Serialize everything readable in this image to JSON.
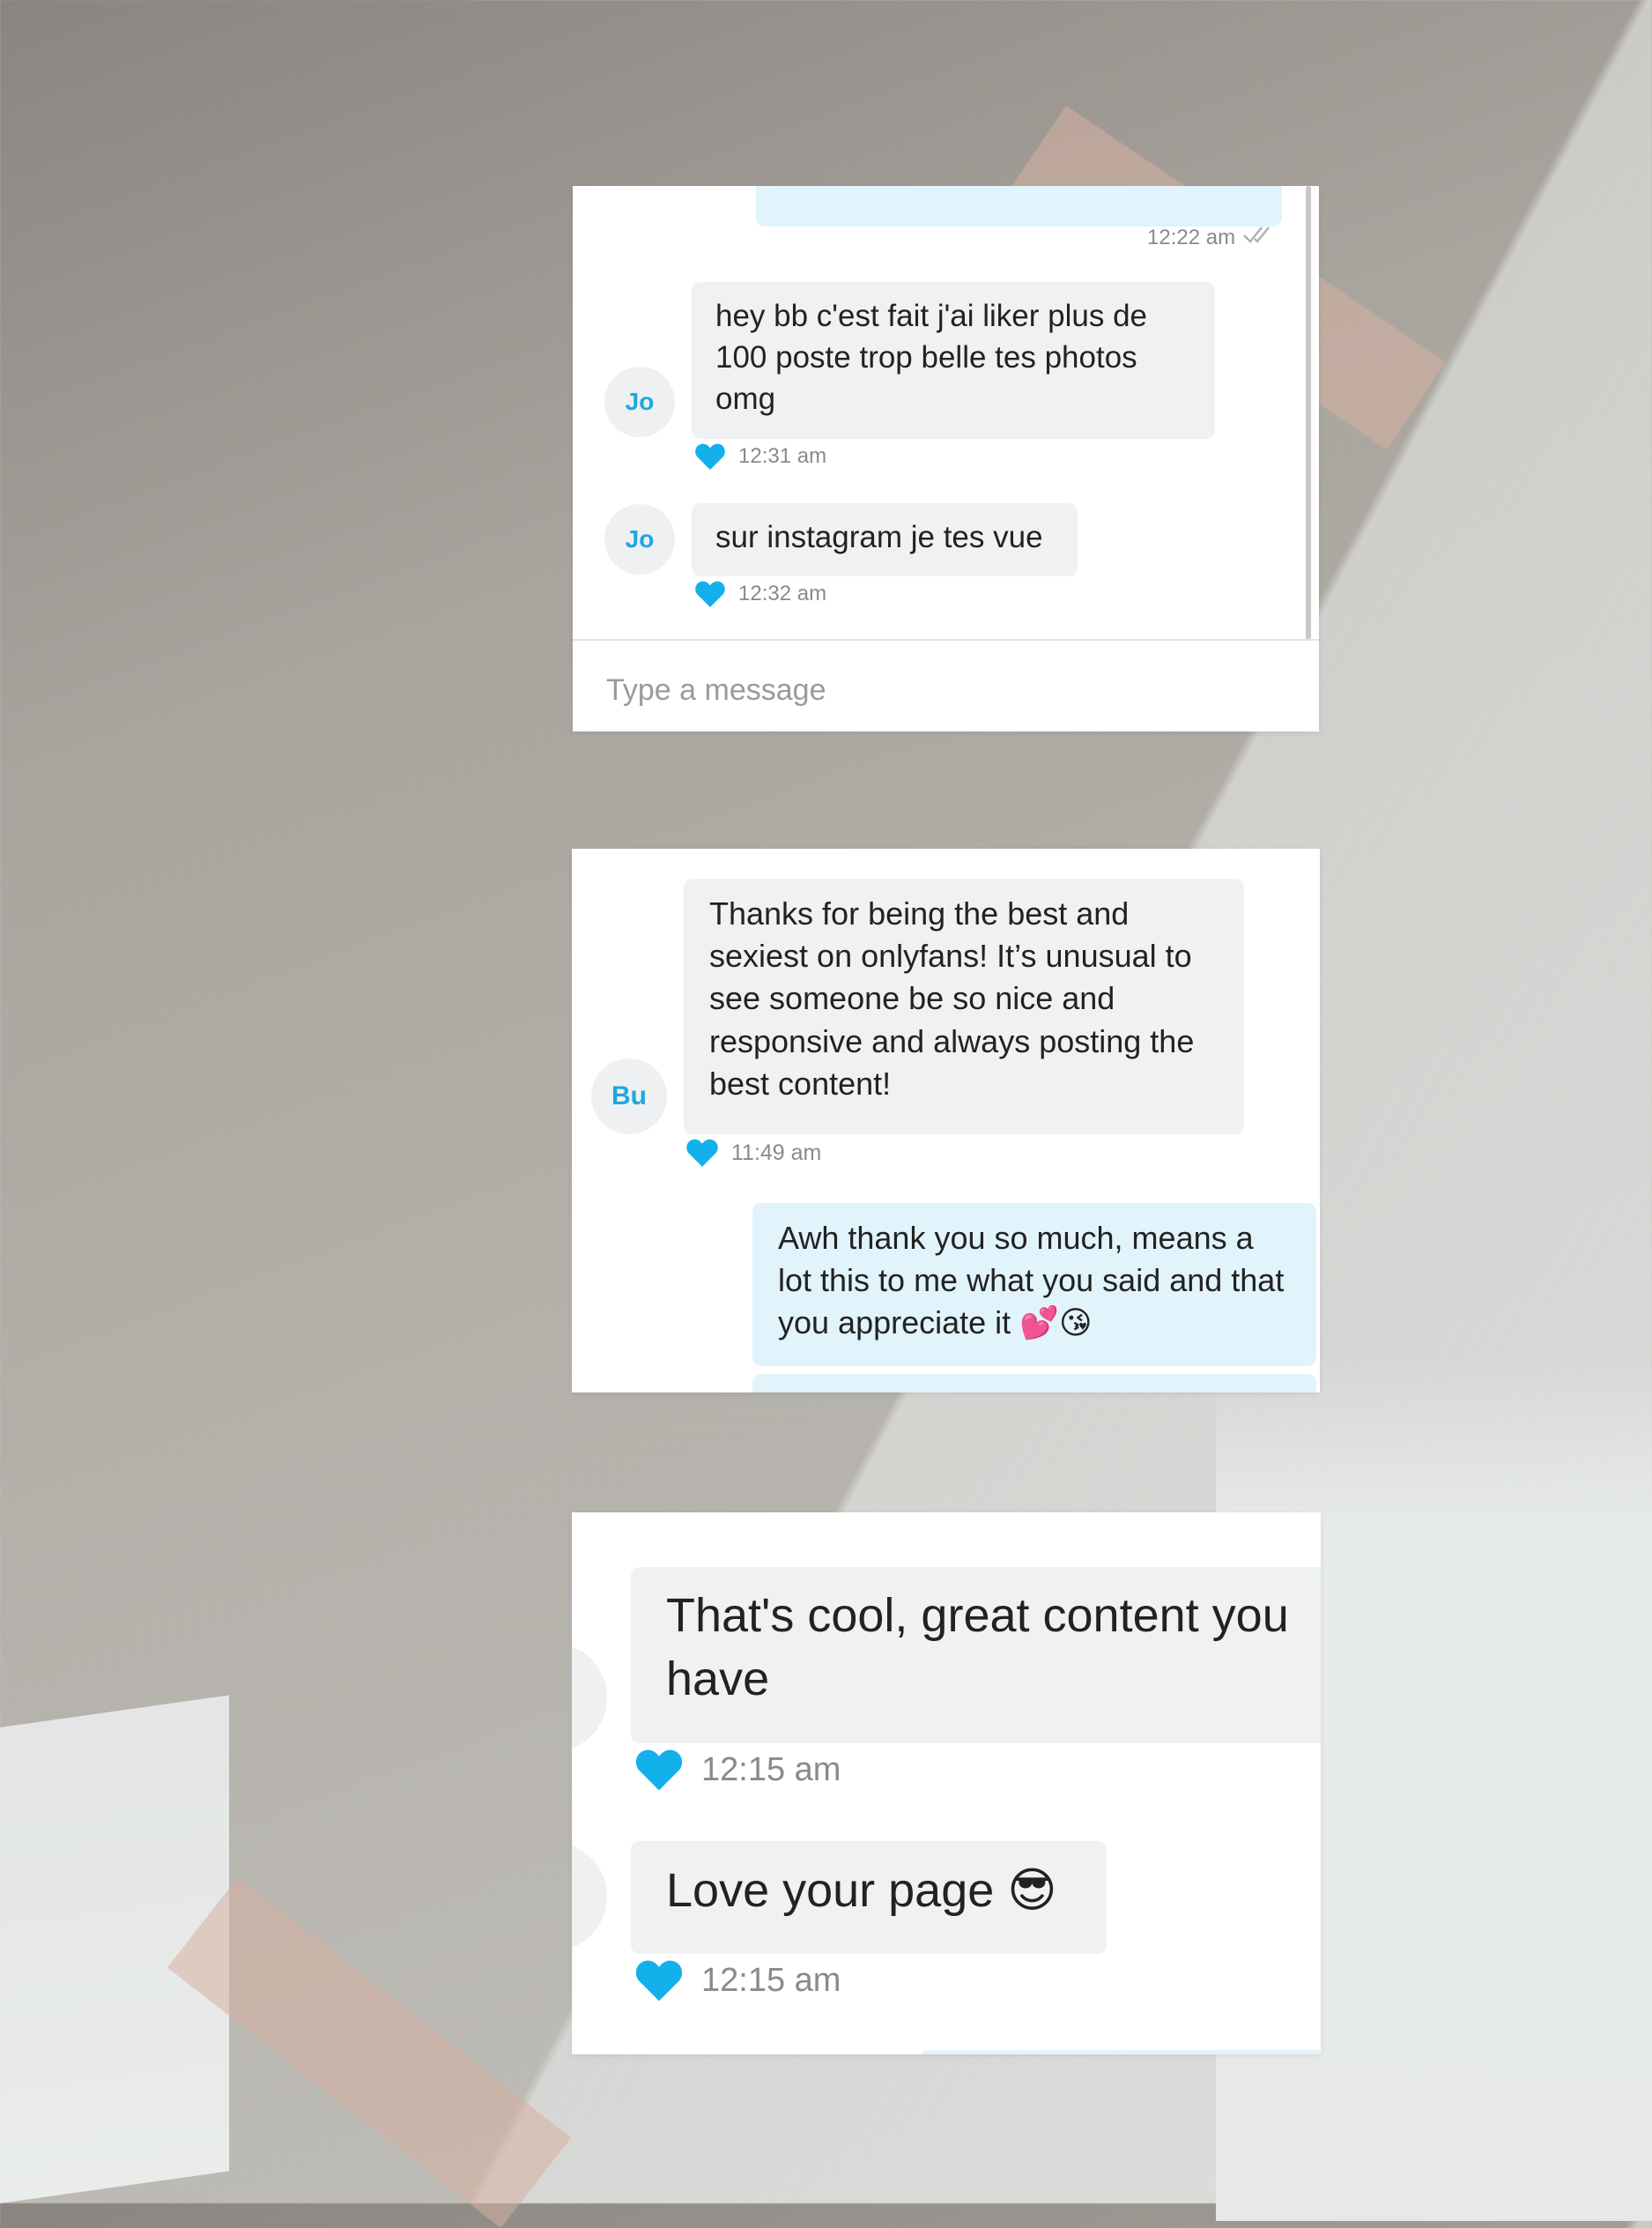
{
  "card1": {
    "top_timestamp": "12:22 am",
    "messages": [
      {
        "avatar": "Jo",
        "text": "hey bb c'est fait j'ai liker plus de 100 poste trop belle tes photos omg",
        "time": "12:31 am"
      },
      {
        "avatar": "Jo",
        "text": "sur instagram je tes vue",
        "time": "12:32 am"
      }
    ],
    "composer_placeholder": "Type a message"
  },
  "card2": {
    "incoming": {
      "avatar": "Bu",
      "text": "Thanks for being the best and sexiest on onlyfans! It’s unusual to see someone be so nice and responsive and always posting the best content!",
      "time": "11:49 am"
    },
    "outgoing": {
      "text": "Awh thank you so much, means a lot this to me what you said and that you appreciate it",
      "emoji": "💕😘"
    }
  },
  "card3": {
    "messages": [
      {
        "text": "That's cool, great content you have",
        "time": "12:15 am"
      },
      {
        "text": "Love your page",
        "emoji": "😎",
        "time": "12:15 am"
      }
    ]
  },
  "colors": {
    "accent": "#1fa7df",
    "incoming_bubble": "#f0f1f2",
    "outgoing_bubble": "#e1f3fb",
    "heart": "#12b1ec"
  },
  "icons": [
    "heart-icon",
    "double-check-icon"
  ]
}
